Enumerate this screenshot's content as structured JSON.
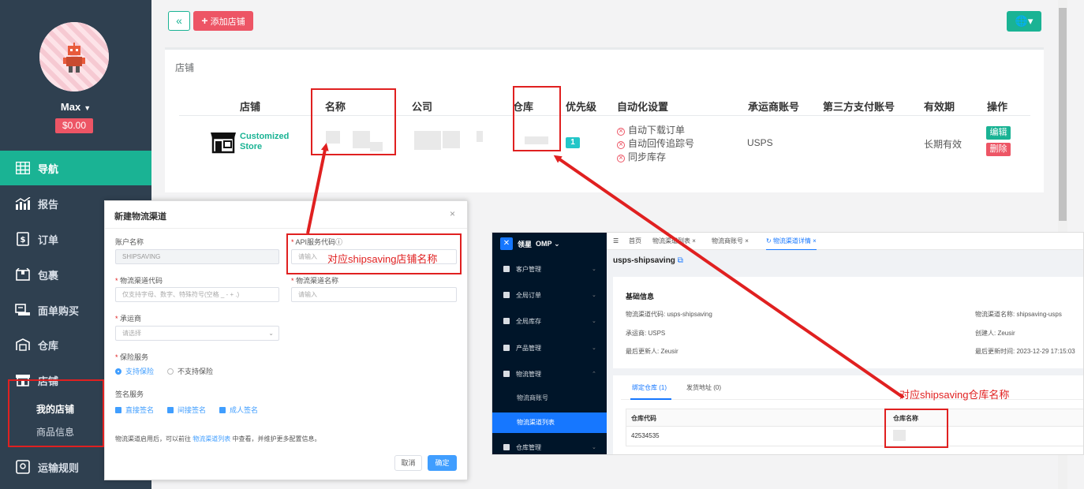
{
  "sidebar": {
    "user_name": "Max",
    "balance": "$0.00",
    "items": [
      {
        "label": "导航",
        "icon": "grid-icon"
      },
      {
        "label": "报告",
        "icon": "chart-icon"
      },
      {
        "label": "订单",
        "icon": "order-icon"
      },
      {
        "label": "包裹",
        "icon": "package-icon"
      },
      {
        "label": "面单购买",
        "icon": "label-icon"
      },
      {
        "label": "仓库",
        "icon": "warehouse-icon"
      },
      {
        "label": "店铺",
        "icon": "store-icon"
      },
      {
        "label": "运输规则",
        "icon": "rule-icon"
      }
    ],
    "sub_items": [
      "我的店铺",
      "商品信息"
    ]
  },
  "toolbar": {
    "collapse": "«",
    "add_store": "添加店铺",
    "lang": "🌐▾"
  },
  "store_panel": {
    "title": "店铺",
    "headers": [
      "店铺",
      "名称",
      "公司",
      "仓库",
      "优先级",
      "自动化设置",
      "承运商账号",
      "第三方支付账号",
      "有效期",
      "操作"
    ],
    "row": {
      "logo_line1": "Customized",
      "logo_line2": "Store",
      "priority": "1",
      "automation": [
        "自动下载订单",
        "自动回传追踪号",
        "同步库存"
      ],
      "carrier": "USPS",
      "validity": "长期有效",
      "edit": "编辑",
      "delete": "删除"
    }
  },
  "modal": {
    "title": "新建物流渠道",
    "close": "×",
    "account_label": "账户名称",
    "account_value": "SHIPSAVING",
    "api_label": "API服务代码ⓘ",
    "api_placeholder": "请输入",
    "channel_code_label": "物流渠道代码",
    "channel_code_placeholder": "仅支持字母、数字、特殊符号(空格 _ - + .)",
    "channel_name_label": "物流渠道名称",
    "channel_name_placeholder": "请输入",
    "carrier_label": "承运商",
    "carrier_placeholder": "请选择",
    "insurance_label": "保险服务",
    "insurance_yes": "支持保险",
    "insurance_no": "不支持保险",
    "signature_label": "签名服务",
    "sig_direct": "直接签名",
    "sig_indirect": "间接签名",
    "sig_adult": "成人签名",
    "note_prefix": "物流渠道启用后，可以前往 ",
    "note_link": "物流渠道列表",
    "note_suffix": " 中查看，并维护更多配置信息。",
    "cancel": "取消",
    "ok": "确定"
  },
  "annotations": {
    "store_name": "对应shipsaving店铺名称",
    "warehouse_name": "对应shipsaving仓库名称"
  },
  "omp": {
    "brand": "领星",
    "product": "OMP",
    "nav": [
      "客户管理",
      "全局订单",
      "全局库存",
      "产品管理",
      "物流管理",
      "仓库管理"
    ],
    "sub_nav": [
      "物流商账号",
      "物流渠道列表"
    ],
    "tabs": [
      "首页",
      "物流渠道列表",
      "物流商账号",
      "物流渠道详情"
    ],
    "page_title": "usps-shipsaving",
    "info_title": "基础信息",
    "info": {
      "code_label": "物流渠道代码:",
      "code_value": "usps-shipsaving",
      "name_label": "物流渠道名称:",
      "name_value": "shipsaving-usps",
      "carrier_label": "承运商:",
      "carrier_value": "USPS",
      "creator_label": "创建人:",
      "creator_value": "Zeusir",
      "updater_label": "最后更新人:",
      "updater_value": "Zeusir",
      "updated_label": "最后更新时间:",
      "updated_value": "2023-12-29 17:15:03"
    },
    "bind_tabs": [
      "绑定仓库 (1)",
      "发货地址 (0)"
    ],
    "table_headers": [
      "仓库代码",
      "仓库名称"
    ],
    "table_row": [
      "42534535",
      ""
    ]
  },
  "colors": {
    "primary": "#1ab394",
    "danger": "#ed5565",
    "sidebar": "#2f4050",
    "annotation": "#e02020",
    "omp_blue": "#1677ff"
  }
}
